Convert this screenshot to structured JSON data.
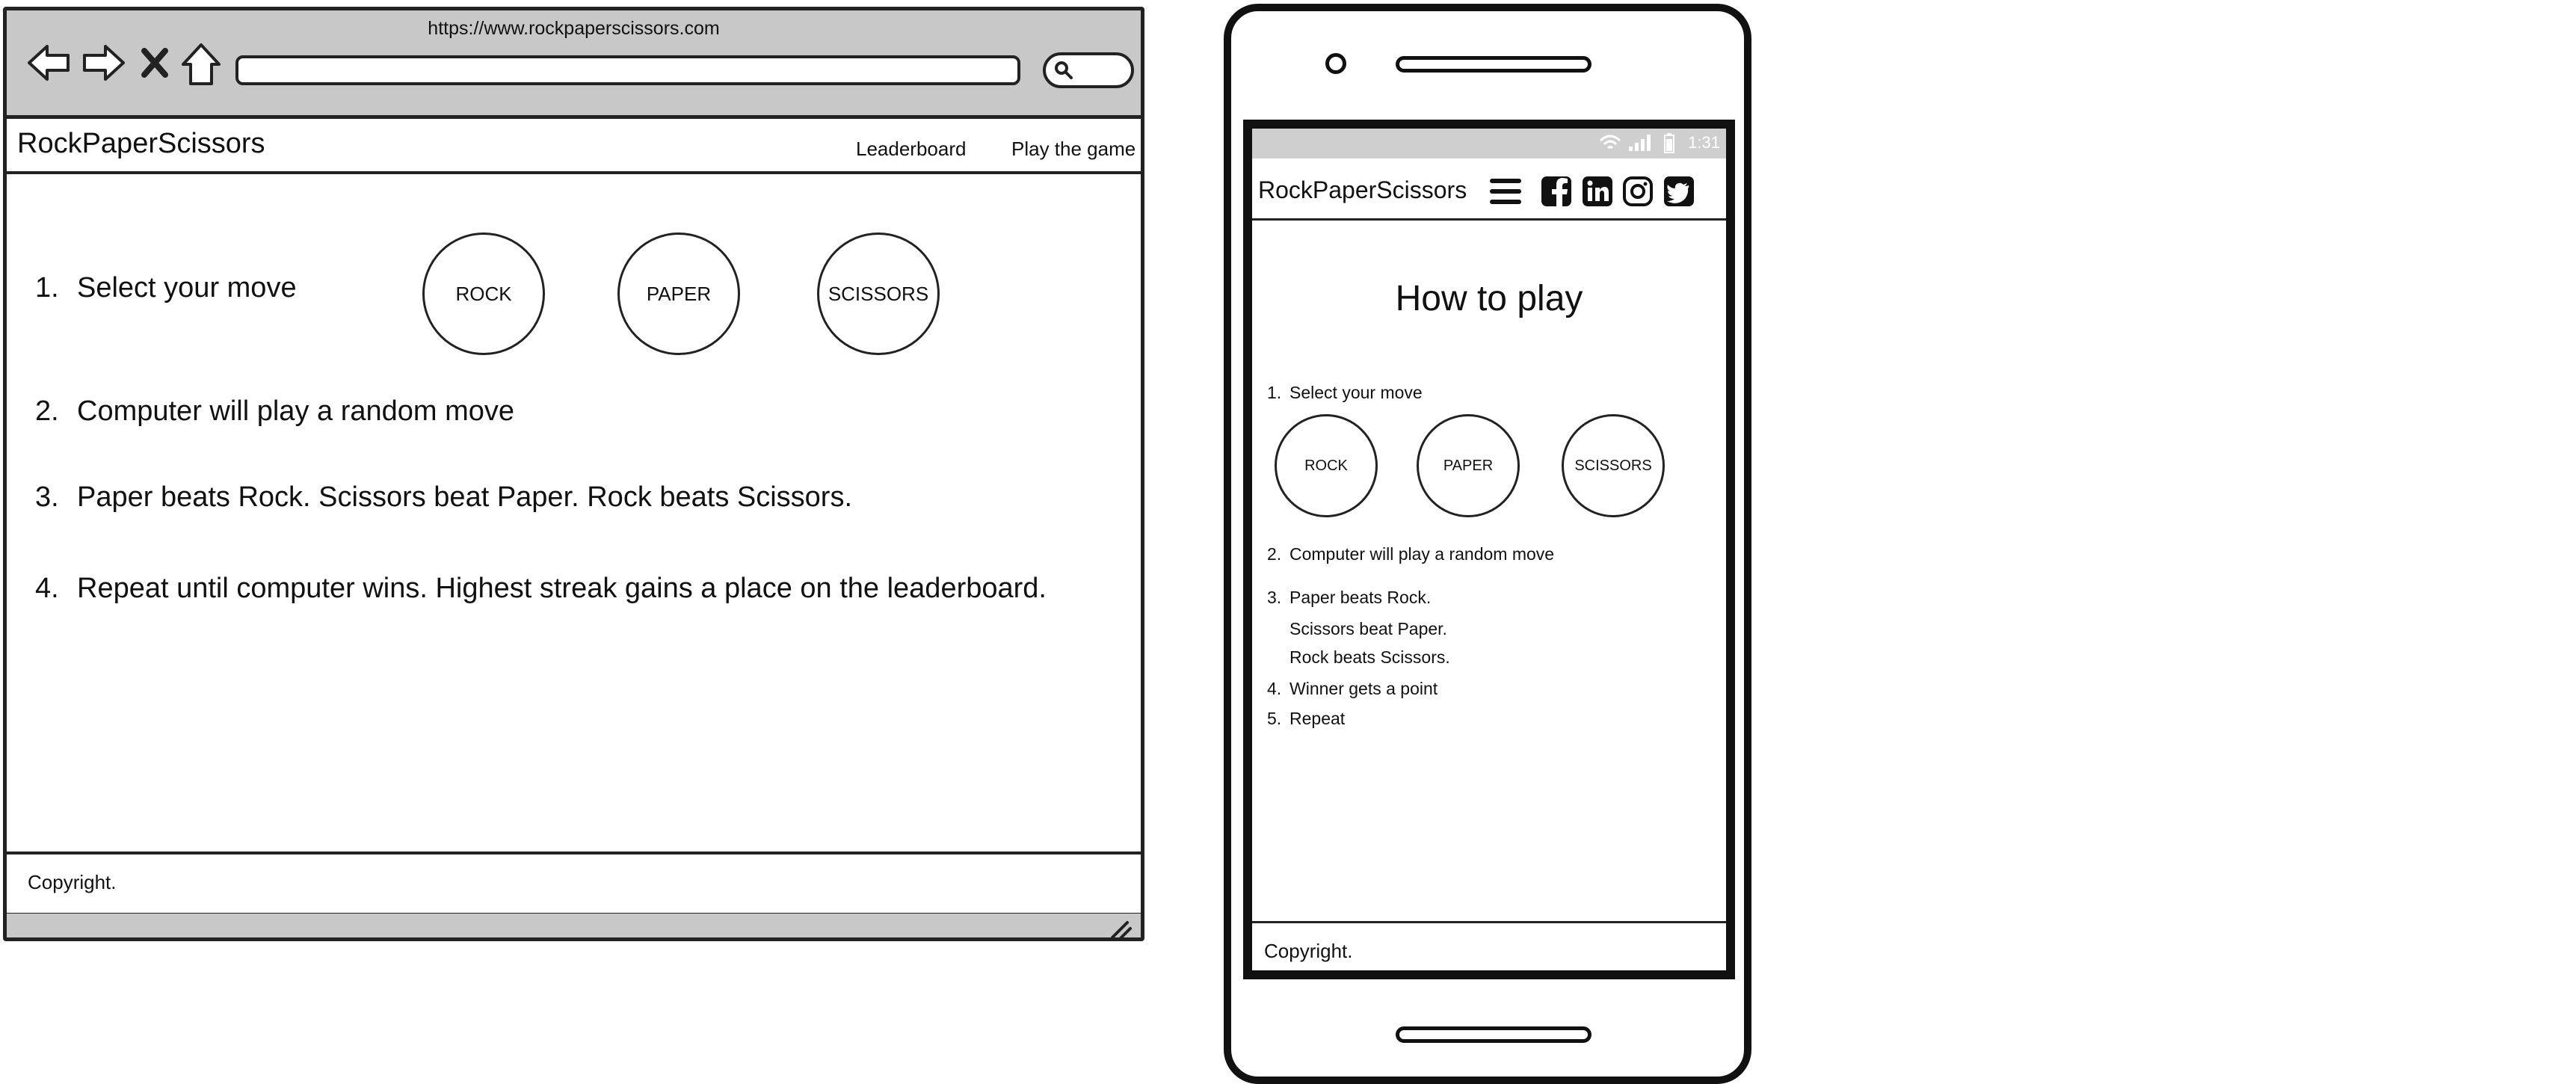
{
  "browser": {
    "url": "https://www.rockpaperscissors.com"
  },
  "desktop": {
    "brand": "RockPaperScissors",
    "nav": [
      "Leaderboard",
      "Play the game"
    ],
    "steps": [
      {
        "num": "1.",
        "text": "Select your move"
      },
      {
        "num": "2.",
        "text": "Computer will play a random move"
      },
      {
        "num": "3.",
        "text": "Paper beats Rock.  Scissors beat Paper.  Rock beats Scissors."
      },
      {
        "num": "4.",
        "text": "Repeat until computer wins.  Highest streak gains a place on the leaderboard."
      }
    ],
    "moves": [
      "ROCK",
      "PAPER",
      "SCISSORS"
    ],
    "footer": "Copyright."
  },
  "mobile": {
    "status_time": "1:31",
    "brand": "RockPaperScissors",
    "title": "How to play",
    "steps": [
      {
        "num": "1.",
        "text": "Select your move"
      },
      {
        "num": "2.",
        "text": "Computer will play a random move"
      },
      {
        "num": "3.",
        "text": "Paper beats Rock."
      },
      {
        "num": "4.",
        "text": "Winner gets a point"
      },
      {
        "num": "5.",
        "text": "Repeat"
      }
    ],
    "step3_extra": [
      "Scissors beat Paper.",
      "Rock beats Scissors."
    ],
    "moves": [
      "ROCK",
      "PAPER",
      "SCISSORS"
    ],
    "footer": "Copyright."
  }
}
